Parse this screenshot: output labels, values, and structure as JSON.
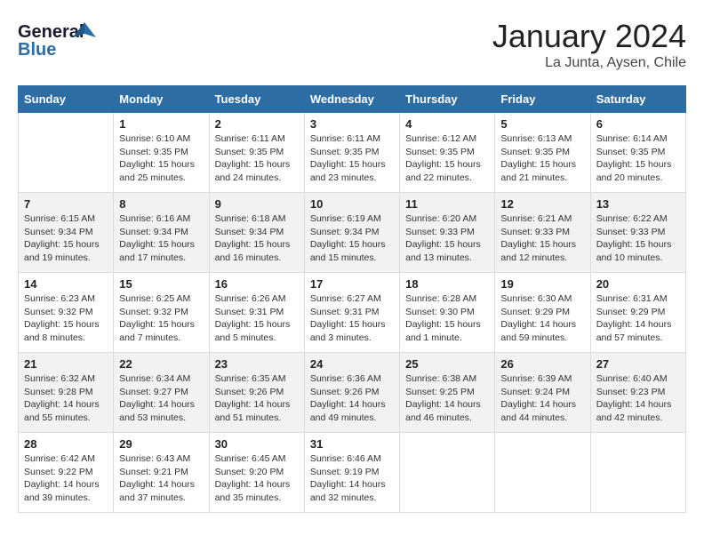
{
  "logo": {
    "line1": "General",
    "line2": "Blue"
  },
  "title": "January 2024",
  "subtitle": "La Junta, Aysen, Chile",
  "days_of_week": [
    "Sunday",
    "Monday",
    "Tuesday",
    "Wednesday",
    "Thursday",
    "Friday",
    "Saturday"
  ],
  "weeks": [
    [
      {
        "day": "",
        "info": ""
      },
      {
        "day": "1",
        "info": "Sunrise: 6:10 AM\nSunset: 9:35 PM\nDaylight: 15 hours\nand 25 minutes."
      },
      {
        "day": "2",
        "info": "Sunrise: 6:11 AM\nSunset: 9:35 PM\nDaylight: 15 hours\nand 24 minutes."
      },
      {
        "day": "3",
        "info": "Sunrise: 6:11 AM\nSunset: 9:35 PM\nDaylight: 15 hours\nand 23 minutes."
      },
      {
        "day": "4",
        "info": "Sunrise: 6:12 AM\nSunset: 9:35 PM\nDaylight: 15 hours\nand 22 minutes."
      },
      {
        "day": "5",
        "info": "Sunrise: 6:13 AM\nSunset: 9:35 PM\nDaylight: 15 hours\nand 21 minutes."
      },
      {
        "day": "6",
        "info": "Sunrise: 6:14 AM\nSunset: 9:35 PM\nDaylight: 15 hours\nand 20 minutes."
      }
    ],
    [
      {
        "day": "7",
        "info": "Sunrise: 6:15 AM\nSunset: 9:34 PM\nDaylight: 15 hours\nand 19 minutes."
      },
      {
        "day": "8",
        "info": "Sunrise: 6:16 AM\nSunset: 9:34 PM\nDaylight: 15 hours\nand 17 minutes."
      },
      {
        "day": "9",
        "info": "Sunrise: 6:18 AM\nSunset: 9:34 PM\nDaylight: 15 hours\nand 16 minutes."
      },
      {
        "day": "10",
        "info": "Sunrise: 6:19 AM\nSunset: 9:34 PM\nDaylight: 15 hours\nand 15 minutes."
      },
      {
        "day": "11",
        "info": "Sunrise: 6:20 AM\nSunset: 9:33 PM\nDaylight: 15 hours\nand 13 minutes."
      },
      {
        "day": "12",
        "info": "Sunrise: 6:21 AM\nSunset: 9:33 PM\nDaylight: 15 hours\nand 12 minutes."
      },
      {
        "day": "13",
        "info": "Sunrise: 6:22 AM\nSunset: 9:33 PM\nDaylight: 15 hours\nand 10 minutes."
      }
    ],
    [
      {
        "day": "14",
        "info": "Sunrise: 6:23 AM\nSunset: 9:32 PM\nDaylight: 15 hours\nand 8 minutes."
      },
      {
        "day": "15",
        "info": "Sunrise: 6:25 AM\nSunset: 9:32 PM\nDaylight: 15 hours\nand 7 minutes."
      },
      {
        "day": "16",
        "info": "Sunrise: 6:26 AM\nSunset: 9:31 PM\nDaylight: 15 hours\nand 5 minutes."
      },
      {
        "day": "17",
        "info": "Sunrise: 6:27 AM\nSunset: 9:31 PM\nDaylight: 15 hours\nand 3 minutes."
      },
      {
        "day": "18",
        "info": "Sunrise: 6:28 AM\nSunset: 9:30 PM\nDaylight: 15 hours\nand 1 minute."
      },
      {
        "day": "19",
        "info": "Sunrise: 6:30 AM\nSunset: 9:29 PM\nDaylight: 14 hours\nand 59 minutes."
      },
      {
        "day": "20",
        "info": "Sunrise: 6:31 AM\nSunset: 9:29 PM\nDaylight: 14 hours\nand 57 minutes."
      }
    ],
    [
      {
        "day": "21",
        "info": "Sunrise: 6:32 AM\nSunset: 9:28 PM\nDaylight: 14 hours\nand 55 minutes."
      },
      {
        "day": "22",
        "info": "Sunrise: 6:34 AM\nSunset: 9:27 PM\nDaylight: 14 hours\nand 53 minutes."
      },
      {
        "day": "23",
        "info": "Sunrise: 6:35 AM\nSunset: 9:26 PM\nDaylight: 14 hours\nand 51 minutes."
      },
      {
        "day": "24",
        "info": "Sunrise: 6:36 AM\nSunset: 9:26 PM\nDaylight: 14 hours\nand 49 minutes."
      },
      {
        "day": "25",
        "info": "Sunrise: 6:38 AM\nSunset: 9:25 PM\nDaylight: 14 hours\nand 46 minutes."
      },
      {
        "day": "26",
        "info": "Sunrise: 6:39 AM\nSunset: 9:24 PM\nDaylight: 14 hours\nand 44 minutes."
      },
      {
        "day": "27",
        "info": "Sunrise: 6:40 AM\nSunset: 9:23 PM\nDaylight: 14 hours\nand 42 minutes."
      }
    ],
    [
      {
        "day": "28",
        "info": "Sunrise: 6:42 AM\nSunset: 9:22 PM\nDaylight: 14 hours\nand 39 minutes."
      },
      {
        "day": "29",
        "info": "Sunrise: 6:43 AM\nSunset: 9:21 PM\nDaylight: 14 hours\nand 37 minutes."
      },
      {
        "day": "30",
        "info": "Sunrise: 6:45 AM\nSunset: 9:20 PM\nDaylight: 14 hours\nand 35 minutes."
      },
      {
        "day": "31",
        "info": "Sunrise: 6:46 AM\nSunset: 9:19 PM\nDaylight: 14 hours\nand 32 minutes."
      },
      {
        "day": "",
        "info": ""
      },
      {
        "day": "",
        "info": ""
      },
      {
        "day": "",
        "info": ""
      }
    ]
  ]
}
